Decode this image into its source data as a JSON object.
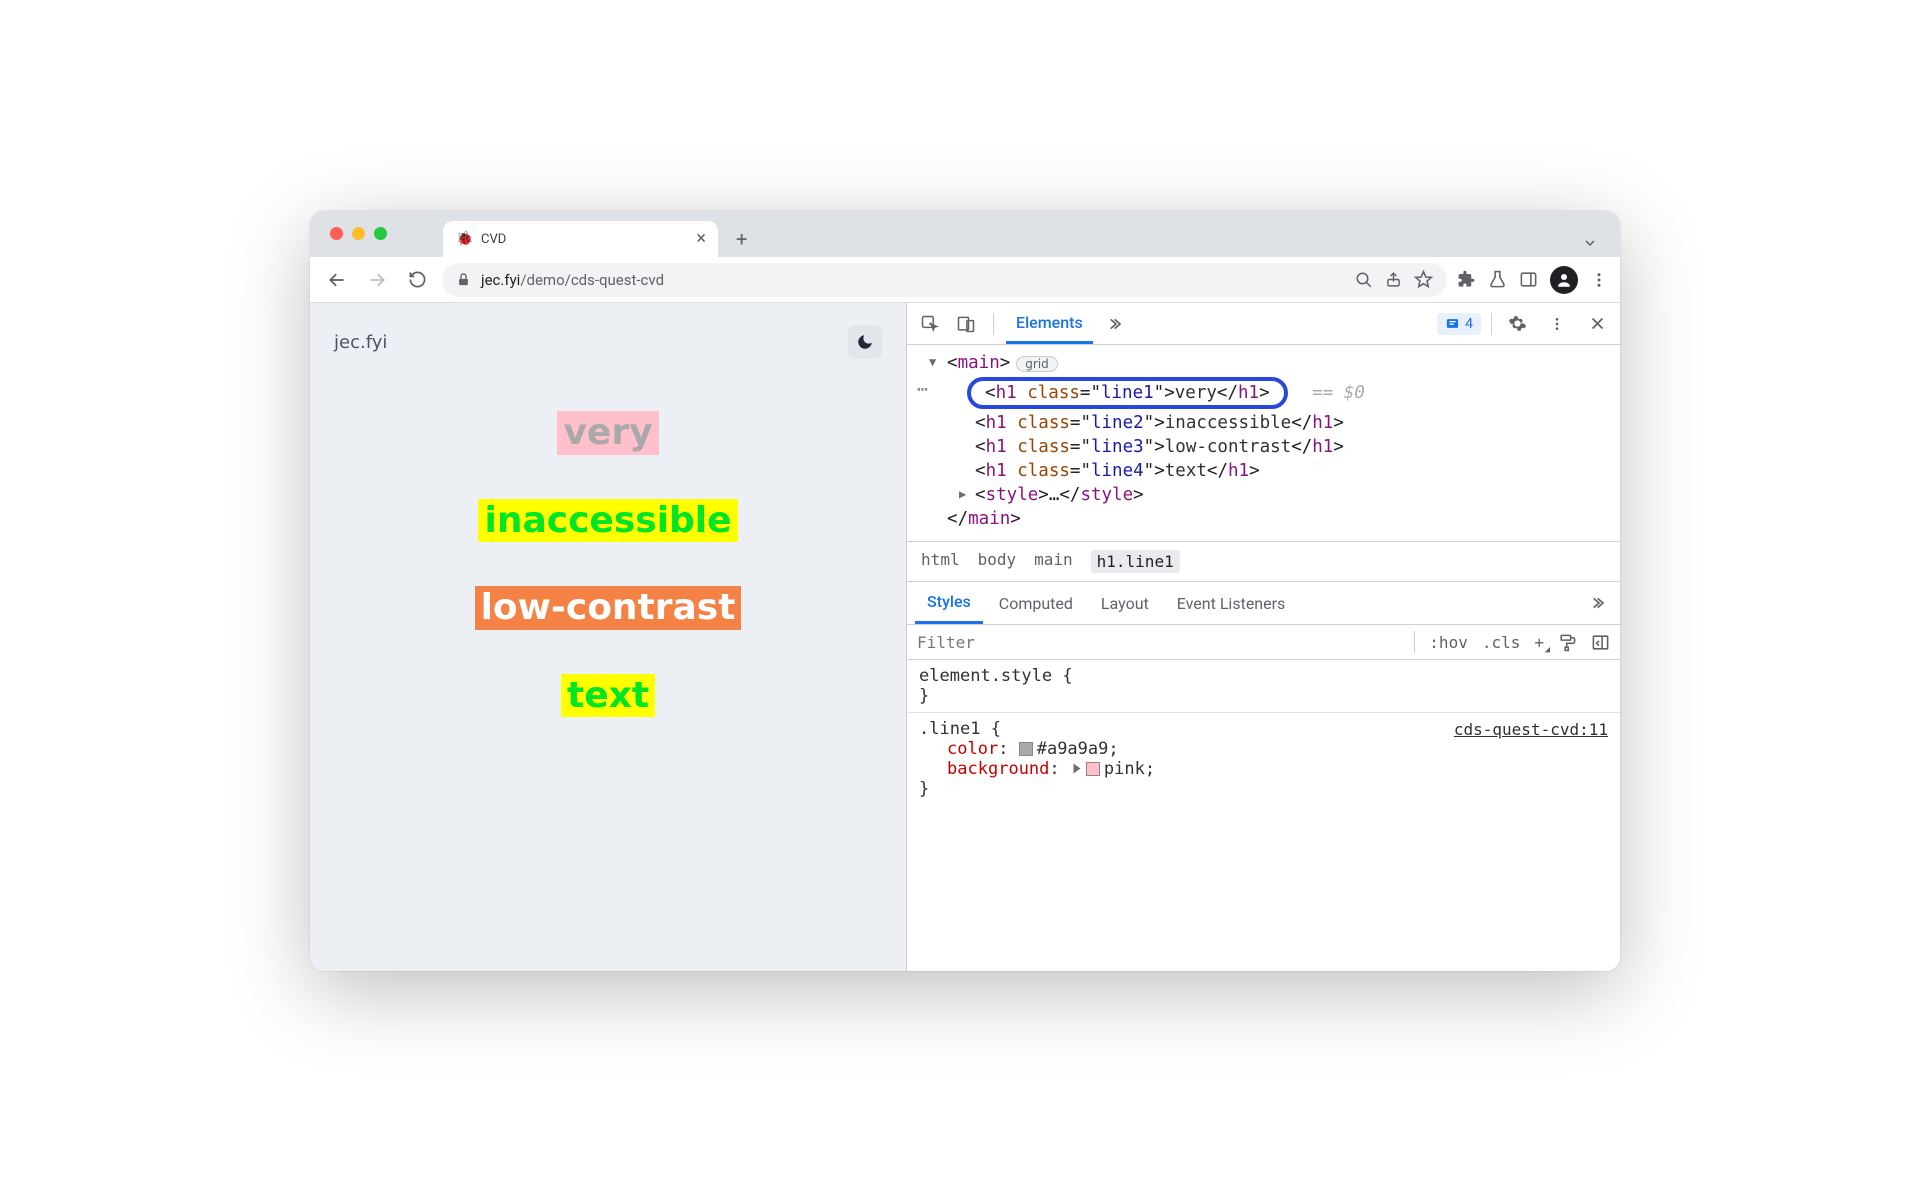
{
  "tab": {
    "title": "CVD",
    "favicon": "🐞"
  },
  "url": {
    "host": "jec.fyi",
    "path": "/demo/cds-quest-cvd"
  },
  "page": {
    "brand": "jec.fyi",
    "line1": "very",
    "line2": "inaccessible",
    "line3": "low-contrast",
    "line4": "text"
  },
  "devtools": {
    "panel_active": "Elements",
    "issues_count": "4",
    "dom": {
      "main_open": "main",
      "grid_badge": "grid",
      "h1_line1_tag": "h1",
      "h1_line1_cls": "line1",
      "h1_line1_text": "very",
      "eq0": "== $0",
      "h1_line2_tag": "h1",
      "h1_line2_cls": "line2",
      "h1_line2_text": "inaccessible",
      "h1_line3_tag": "h1",
      "h1_line3_cls": "line3",
      "h1_line3_text": "low-contrast",
      "h1_line4_tag": "h1",
      "h1_line4_cls": "line4",
      "h1_line4_text": "text",
      "style_open": "style",
      "style_ellipsis": "…",
      "main_close": "main"
    },
    "crumbs": {
      "c1": "html",
      "c2": "body",
      "c3": "main",
      "c4": "h1.line1"
    },
    "styles_tabs": {
      "t1": "Styles",
      "t2": "Computed",
      "t3": "Layout",
      "t4": "Event Listeners"
    },
    "filter_placeholder": "Filter",
    "filter_hov": ":hov",
    "filter_cls": ".cls",
    "styles": {
      "element_style": "element.style {",
      "close_brace": "}",
      "rule_selector": ".line1 {",
      "rule_source": "cds-quest-cvd:11",
      "color_prop": "color",
      "color_val": "#a9a9a9",
      "bg_prop": "background",
      "bg_val": "pink",
      "colon": ": ",
      "semi": ";"
    }
  }
}
